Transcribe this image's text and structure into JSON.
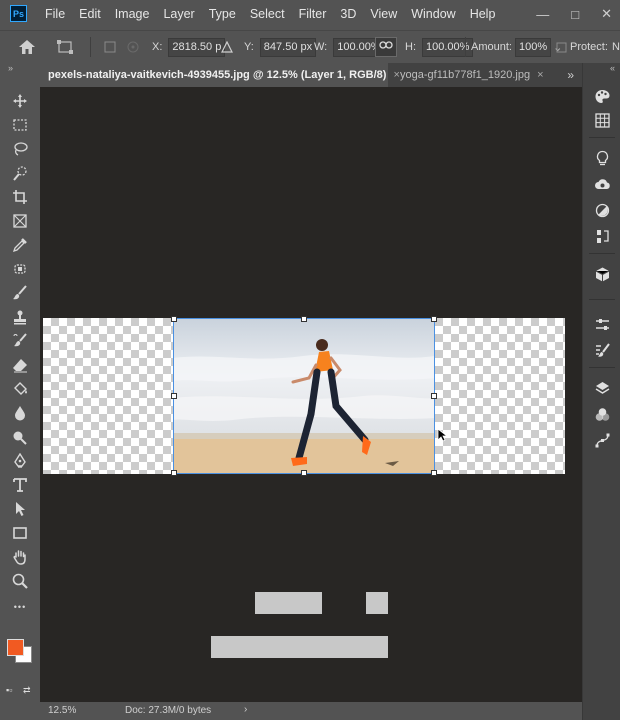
{
  "app": {
    "logo_text": "Ps",
    "accent": "#31a8ff"
  },
  "menu": {
    "items": [
      "File",
      "Edit",
      "Image",
      "Layer",
      "Type",
      "Select",
      "Filter",
      "3D",
      "View",
      "Window",
      "Help"
    ]
  },
  "window_controls": {
    "minimize": "—",
    "maximize": "□",
    "close": "✕"
  },
  "options": {
    "x_label": "X:",
    "x_value": "2818.50 p",
    "y_label": "Y:",
    "y_value": "847.50 px",
    "w_label": "W:",
    "w_value": "100.00%",
    "h_label": "H:",
    "h_value": "100.00%",
    "amount_label": "Amount:",
    "amount_value": "100%",
    "protect_label": "Protect:",
    "trailing_text": "N"
  },
  "tabs": [
    {
      "label": "pexels-nataliya-vaitkevich-4939455.jpg @ 12.5% (Layer 1, RGB/8)",
      "close": "×",
      "active": true
    },
    {
      "label": "yoga-gf11b778f1_1920.jpg",
      "close": "×",
      "active": false
    }
  ],
  "tabs_more": "»",
  "toolbar": {
    "collapse": "»",
    "more": "•••",
    "foreground_color": "#f15a22",
    "background_color": "#ffffff"
  },
  "status": {
    "zoom": "12.5%",
    "doc_info": "Doc: 27.3M/0 bytes",
    "arrow": "›"
  },
  "rightdock": {
    "collapse": "«"
  }
}
